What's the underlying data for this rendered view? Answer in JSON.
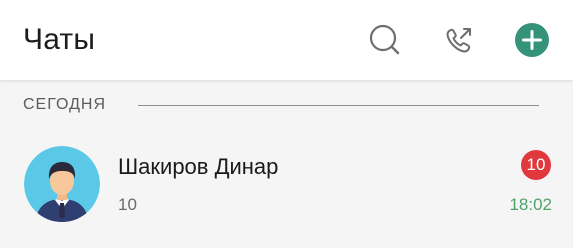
{
  "header": {
    "title": "Чаты"
  },
  "icons": {
    "search": "search-icon",
    "calls": "phone-outgoing-icon",
    "add": "plus-circle-icon",
    "avatar": "user-avatar-icon"
  },
  "colors": {
    "accent": "#35937a",
    "badge": "#e1383d",
    "time": "#4fa36a",
    "avatar_bg": "#5bc8e8"
  },
  "section": {
    "label": "СЕГОДНЯ"
  },
  "chats": [
    {
      "name": "Шакиров Динар",
      "preview": "10",
      "unread": "10",
      "time": "18:02"
    }
  ]
}
